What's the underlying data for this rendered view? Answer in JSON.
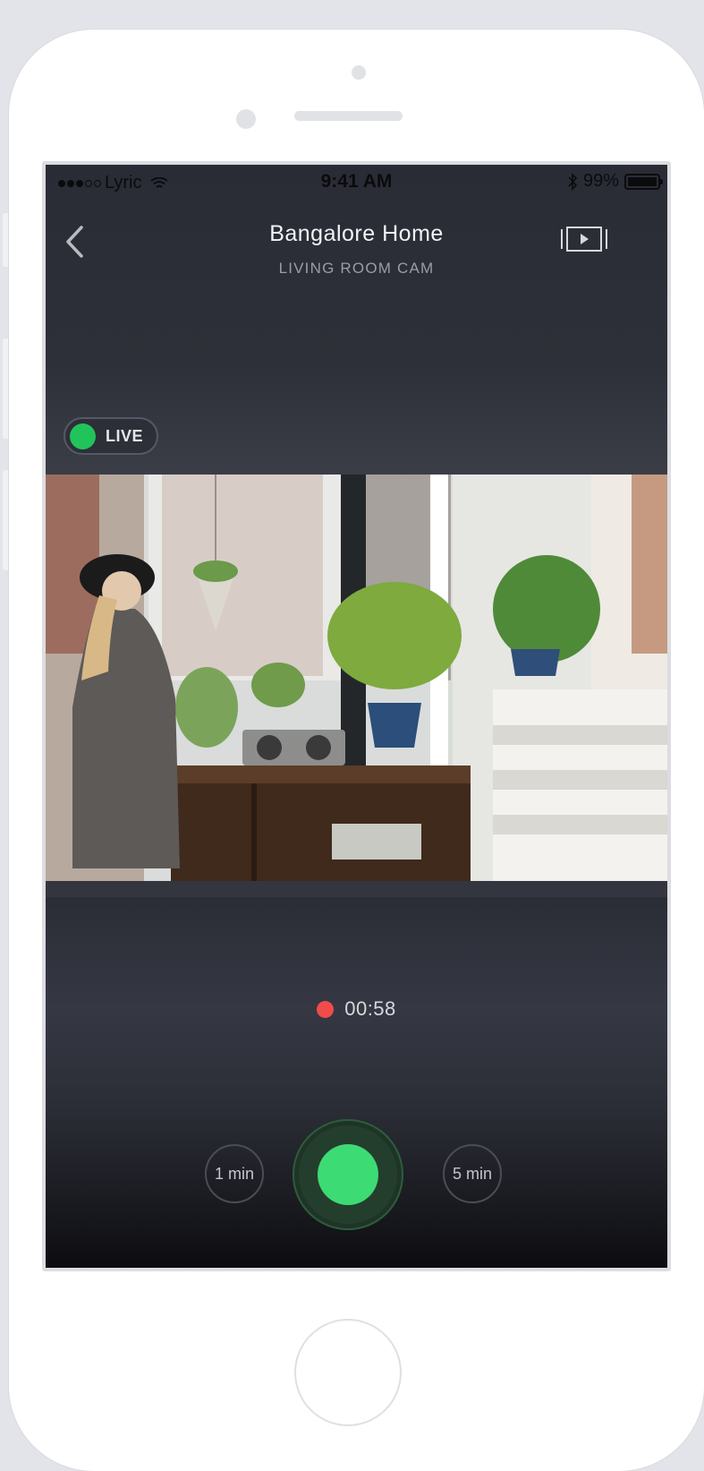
{
  "status_bar": {
    "carrier": "Lyric",
    "time": "9:41 AM",
    "battery": "99%"
  },
  "header": {
    "title": "Bangalore Home",
    "subtitle": "LIVING ROOM CAM"
  },
  "live_badge": {
    "label": "LIVE",
    "color": "#20c45a"
  },
  "recording": {
    "elapsed": "00:58",
    "indicator_color": "#f24b4b"
  },
  "controls": {
    "left_duration": "1 min",
    "right_duration": "5 min",
    "record_color": "#3ddb74"
  },
  "icons": [
    "back-chevron-icon",
    "media-player-icon",
    "wifi-icon",
    "bluetooth-icon",
    "battery-icon"
  ]
}
